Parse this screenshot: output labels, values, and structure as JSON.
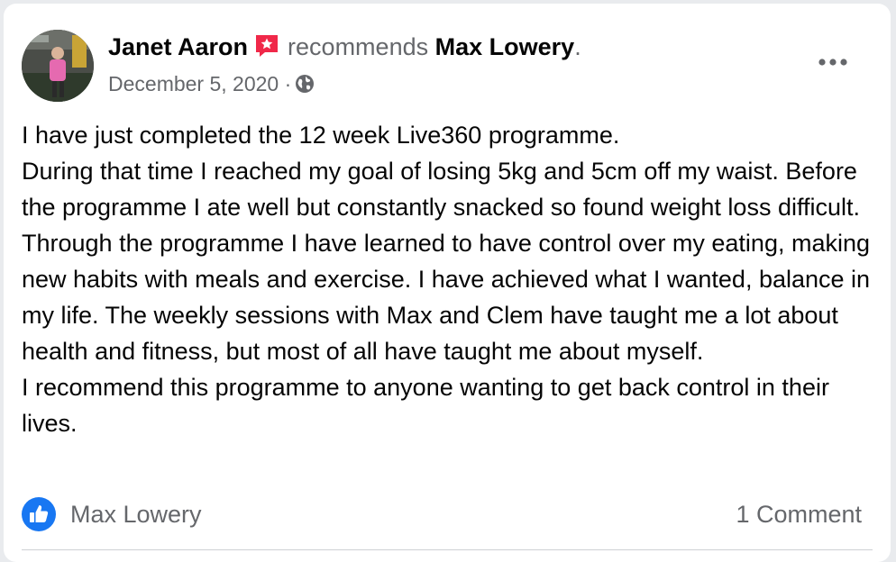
{
  "post": {
    "author": "Janet Aaron",
    "action": "recommends",
    "target": "Max Lowery",
    "trailing_punct": ".",
    "date": "December 5, 2020",
    "separator": "·",
    "audience_icon": "globe-icon",
    "more_icon": "more-options-icon",
    "recommend_icon": "recommendation-badge-icon",
    "body": "I have just completed the 12 week Live360 programme.\nDuring that time I reached my goal of losing 5kg and 5cm off my waist. Before the programme I ate well but constantly snacked so found weight loss difficult. Through the programme I have learned to have control over my eating, making new habits with meals and exercise. I have achieved what I wanted, balance in my life. The weekly sessions with Max and Clem have taught me a lot about health and fitness, but most of all have taught me about myself.\nI recommend this programme to anyone wanting to get back control in their lives."
  },
  "footer": {
    "reaction_icon": "like-reaction-icon",
    "reacted_by": "Max Lowery",
    "comments": "1 Comment"
  },
  "colors": {
    "text": "#050505",
    "secondary": "#65676b",
    "like_blue": "#1877f2",
    "badge_red": "#f02849"
  }
}
